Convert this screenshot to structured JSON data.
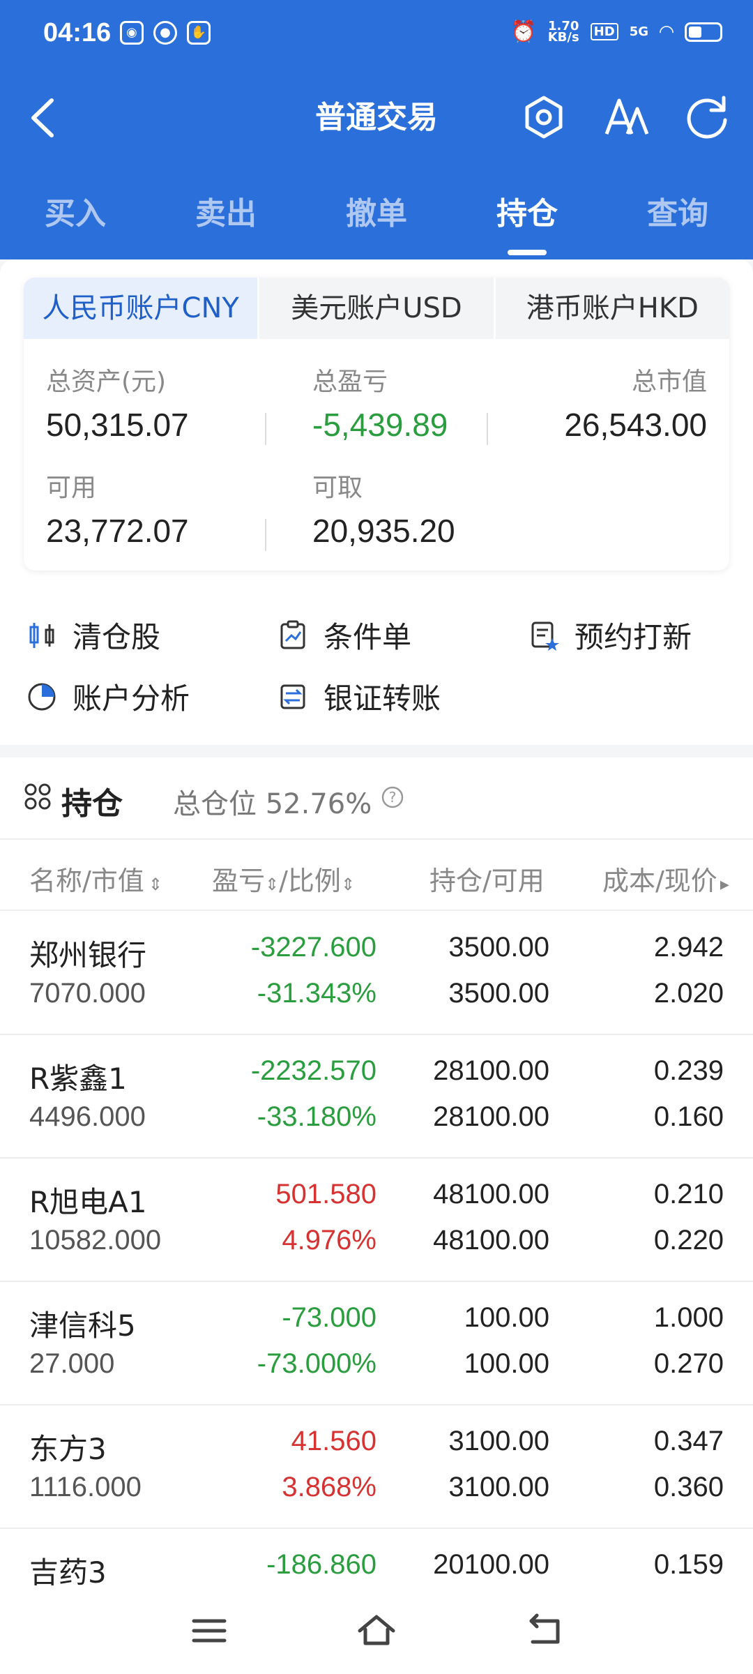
{
  "status_bar": {
    "time": "04:16",
    "net_speed_top": "1.70",
    "net_speed_unit": "KB/s",
    "hd": "HD",
    "signal": "5G"
  },
  "header": {
    "title": "普通交易"
  },
  "tabs": [
    {
      "label": "买入"
    },
    {
      "label": "卖出"
    },
    {
      "label": "撤单"
    },
    {
      "label": "持仓",
      "active": true
    },
    {
      "label": "查询"
    }
  ],
  "currency_tabs": [
    {
      "label": "人民币账户CNY",
      "active": true
    },
    {
      "label": "美元账户USD"
    },
    {
      "label": "港币账户HKD"
    }
  ],
  "summary": {
    "total_assets_label": "总资产(元)",
    "total_assets": "50,315.07",
    "total_pl_label": "总盈亏",
    "total_pl": "-5,439.89",
    "market_value_label": "总市值",
    "market_value": "26,543.00",
    "available_label": "可用",
    "available": "23,772.07",
    "withdrawable_label": "可取",
    "withdrawable": "20,935.20"
  },
  "shortcuts": [
    {
      "label": "清仓股"
    },
    {
      "label": "条件单"
    },
    {
      "label": "预约打新"
    },
    {
      "label": "账户分析"
    },
    {
      "label": "银证转账"
    }
  ],
  "holdings": {
    "title": "持仓",
    "position_label": "总仓位 52.76%",
    "columns": [
      "名称/市值",
      "盈亏",
      "/比例",
      "持仓/可用",
      "成本/现价"
    ],
    "rows": [
      {
        "name": "郑州银行",
        "market_value": "7070.000",
        "pl": "-3227.600",
        "ratio": "-31.343%",
        "hold": "3500.00",
        "available": "3500.00",
        "cost": "2.942",
        "price": "2.020"
      },
      {
        "name": "R紫鑫1",
        "market_value": "4496.000",
        "pl": "-2232.570",
        "ratio": "-33.180%",
        "hold": "28100.00",
        "available": "28100.00",
        "cost": "0.239",
        "price": "0.160"
      },
      {
        "name": "R旭电A1",
        "market_value": "10582.000",
        "pl": "501.580",
        "ratio": "4.976%",
        "hold": "48100.00",
        "available": "48100.00",
        "cost": "0.210",
        "price": "0.220"
      },
      {
        "name": "津信科5",
        "market_value": "27.000",
        "pl": "-73.000",
        "ratio": "-73.000%",
        "hold": "100.00",
        "available": "100.00",
        "cost": "1.000",
        "price": "0.270"
      },
      {
        "name": "东方3",
        "market_value": "1116.000",
        "pl": "41.560",
        "ratio": "3.868%",
        "hold": "3100.00",
        "available": "3100.00",
        "cost": "0.347",
        "price": "0.360"
      },
      {
        "name": "吉药3",
        "market_value": "",
        "pl": "-186.860",
        "ratio": "",
        "hold": "20100.00",
        "available": "",
        "cost": "0.159",
        "price": ""
      }
    ]
  },
  "colors": {
    "header_blue": "#2b6fdb",
    "loss_green": "#2a9d3f",
    "gain_red": "#d63232"
  }
}
